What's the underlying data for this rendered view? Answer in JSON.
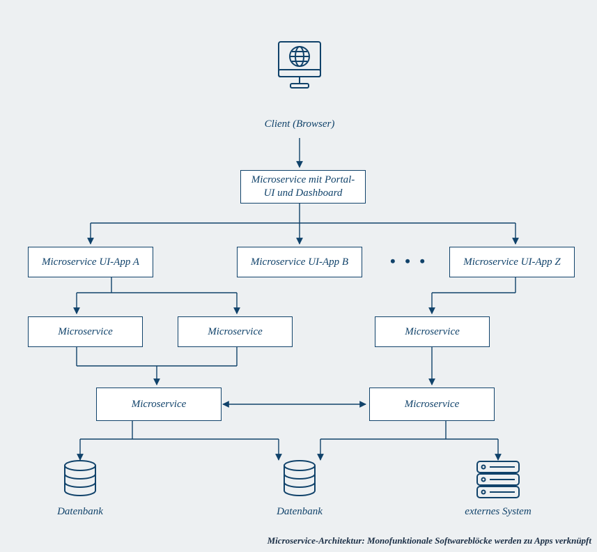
{
  "nodes": {
    "client": "Client (Browser)",
    "portal": "Microservice mit Portal-\nUI und Dashboard",
    "ui_a": "Microservice UI-App A",
    "ui_b": "Microservice UI-App B",
    "ui_z": "Microservice UI-App Z",
    "ms_a1": "Microservice",
    "ms_a2": "Microservice",
    "ms_c": "Microservice",
    "ms_left": "Microservice",
    "ms_right": "Microservice",
    "db_left": "Datenbank",
    "db_center": "Datenbank",
    "ext_system": "externes System"
  },
  "ellipsis": "• • •",
  "caption": "Microservice-Architektur: Monofunktionale Softwareblöcke werden zu Apps verknüpft",
  "colors": {
    "stroke": "#10426a",
    "bg": "#edf0f2",
    "box": "#ffffff"
  }
}
